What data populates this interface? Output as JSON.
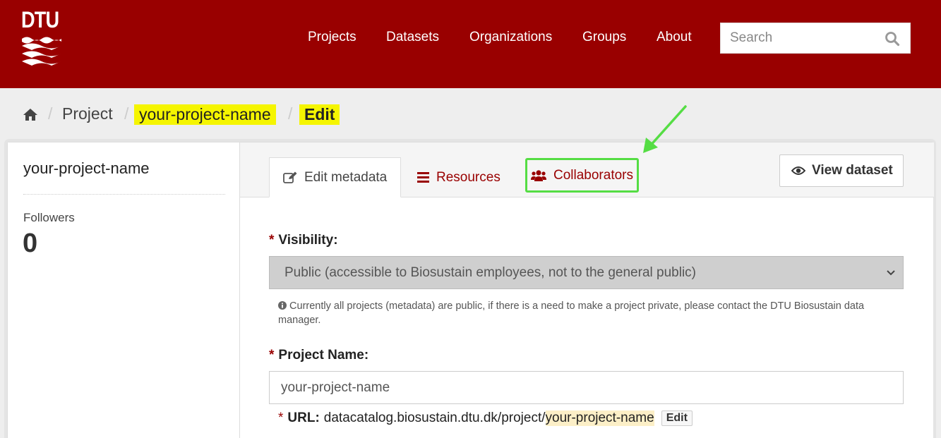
{
  "header": {
    "logo_text": "DTU",
    "nav": [
      {
        "label": "Projects"
      },
      {
        "label": "Datasets"
      },
      {
        "label": "Organizations"
      },
      {
        "label": "Groups"
      },
      {
        "label": "About"
      }
    ],
    "search": {
      "placeholder": "Search",
      "icon": "search-icon"
    },
    "colors": {
      "brand": "#990000"
    }
  },
  "breadcrumb": {
    "home_icon": "home-icon",
    "separator": "/",
    "items": [
      "Project",
      "your-project-name",
      "Edit"
    ]
  },
  "sidebar": {
    "title": "your-project-name",
    "followers_label": "Followers",
    "followers_count": "0"
  },
  "tabs": {
    "edit_metadata": "Edit metadata",
    "resources": "Resources",
    "collaborators": "Collaborators",
    "view_dataset": "View dataset",
    "highlight_color": "#55dd44"
  },
  "form": {
    "required_marker": "*",
    "visibility": {
      "label": "Visibility:",
      "selected": "Public (accessible to Biosustain employees, not to the general public)",
      "help": "Currently all projects (metadata) are public, if there is a need to make a project private, please contact the DTU Biosustain data manager."
    },
    "project_name": {
      "label": "Project Name:",
      "value": "your-project-name"
    },
    "url": {
      "label": "URL:",
      "prefix": "datacatalog.biosustain.dtu.dk/project/",
      "slug": "your-project-name",
      "edit_label": "Edit"
    }
  }
}
